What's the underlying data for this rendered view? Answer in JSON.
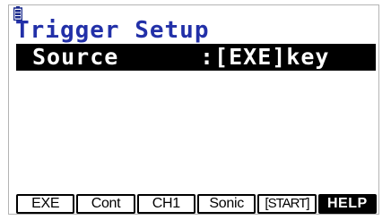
{
  "status_bar": {
    "battery_icon": "battery-icon"
  },
  "screen": {
    "title": "Trigger Setup",
    "setting": {
      "label": "Source",
      "value": ":[EXE]key"
    }
  },
  "function_keys": [
    {
      "label": "EXE"
    },
    {
      "label": "Cont"
    },
    {
      "label": "CH1"
    },
    {
      "label": "Sonic"
    },
    {
      "label": "[START]"
    },
    {
      "label": "HELP"
    }
  ],
  "colors": {
    "title": "#2230a8",
    "highlight_bg": "#000000",
    "highlight_fg": "#ffffff"
  }
}
